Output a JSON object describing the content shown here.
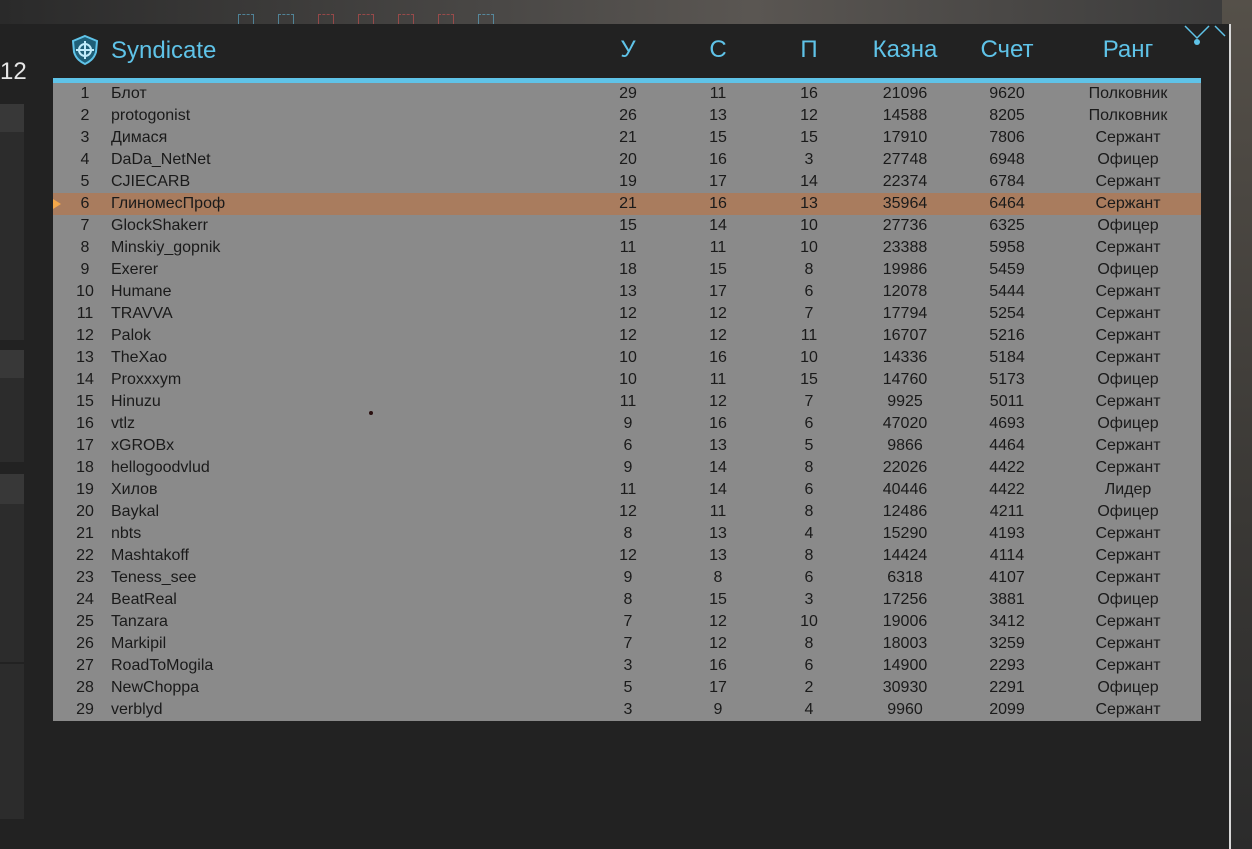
{
  "clan": {
    "name": "Syndicate",
    "logo_icon": "shield-crosshair-icon"
  },
  "side_counter": "12",
  "columns": {
    "u": "У",
    "s": "С",
    "p": "П",
    "kazna": "Казна",
    "schet": "Счет",
    "rank": "Ранг"
  },
  "colors": {
    "accent": "#5fc3e8",
    "highlight_row": "#a97c5e",
    "table_bg": "#8a8a8a",
    "marker": "#f4a84a"
  },
  "rows": [
    {
      "idx": "1",
      "name": "Блот",
      "u": "29",
      "s": "11",
      "p": "16",
      "kazna": "21096",
      "schet": "9620",
      "rank": "Полковник"
    },
    {
      "idx": "2",
      "name": "protogonist",
      "u": "26",
      "s": "13",
      "p": "12",
      "kazna": "14588",
      "schet": "8205",
      "rank": "Полковник"
    },
    {
      "idx": "3",
      "name": "Димася",
      "u": "21",
      "s": "15",
      "p": "15",
      "kazna": "17910",
      "schet": "7806",
      "rank": "Сержант"
    },
    {
      "idx": "4",
      "name": "DaDa_NetNet",
      "u": "20",
      "s": "16",
      "p": "3",
      "kazna": "27748",
      "schet": "6948",
      "rank": "Офицер"
    },
    {
      "idx": "5",
      "name": "CJIECARB",
      "u": "19",
      "s": "17",
      "p": "14",
      "kazna": "22374",
      "schet": "6784",
      "rank": "Сержант"
    },
    {
      "idx": "6",
      "name": "ГлиномесПроф",
      "u": "21",
      "s": "16",
      "p": "13",
      "kazna": "35964",
      "schet": "6464",
      "rank": "Сержант",
      "me": true
    },
    {
      "idx": "7",
      "name": "GlockShakerr",
      "u": "15",
      "s": "14",
      "p": "10",
      "kazna": "27736",
      "schet": "6325",
      "rank": "Офицер"
    },
    {
      "idx": "8",
      "name": "Minskiy_gopnik",
      "u": "11",
      "s": "11",
      "p": "10",
      "kazna": "23388",
      "schet": "5958",
      "rank": "Сержант"
    },
    {
      "idx": "9",
      "name": "Exerer",
      "u": "18",
      "s": "15",
      "p": "8",
      "kazna": "19986",
      "schet": "5459",
      "rank": "Офицер"
    },
    {
      "idx": "10",
      "name": "Humane",
      "u": "13",
      "s": "17",
      "p": "6",
      "kazna": "12078",
      "schet": "5444",
      "rank": "Сержант"
    },
    {
      "idx": "11",
      "name": "TRAVVA",
      "u": "12",
      "s": "12",
      "p": "7",
      "kazna": "17794",
      "schet": "5254",
      "rank": "Сержант"
    },
    {
      "idx": "12",
      "name": "Palok",
      "u": "12",
      "s": "12",
      "p": "11",
      "kazna": "16707",
      "schet": "5216",
      "rank": "Сержант"
    },
    {
      "idx": "13",
      "name": "TheXao",
      "u": "10",
      "s": "16",
      "p": "10",
      "kazna": "14336",
      "schet": "5184",
      "rank": "Сержант"
    },
    {
      "idx": "14",
      "name": "Proxxxym",
      "u": "10",
      "s": "11",
      "p": "15",
      "kazna": "14760",
      "schet": "5173",
      "rank": "Офицер"
    },
    {
      "idx": "15",
      "name": "Hinuzu",
      "u": "11",
      "s": "12",
      "p": "7",
      "kazna": "9925",
      "schet": "5011",
      "rank": "Сержант"
    },
    {
      "idx": "16",
      "name": "vtlz",
      "u": "9",
      "s": "16",
      "p": "6",
      "kazna": "47020",
      "schet": "4693",
      "rank": "Офицер"
    },
    {
      "idx": "17",
      "name": "xGROBx",
      "u": "6",
      "s": "13",
      "p": "5",
      "kazna": "9866",
      "schet": "4464",
      "rank": "Сержант"
    },
    {
      "idx": "18",
      "name": "hellogoodvlud",
      "u": "9",
      "s": "14",
      "p": "8",
      "kazna": "22026",
      "schet": "4422",
      "rank": "Сержант"
    },
    {
      "idx": "19",
      "name": "Хилов",
      "u": "11",
      "s": "14",
      "p": "6",
      "kazna": "40446",
      "schet": "4422",
      "rank": "Лидер"
    },
    {
      "idx": "20",
      "name": "Baykal",
      "u": "12",
      "s": "11",
      "p": "8",
      "kazna": "12486",
      "schet": "4211",
      "rank": "Офицер"
    },
    {
      "idx": "21",
      "name": "nbts",
      "u": "8",
      "s": "13",
      "p": "4",
      "kazna": "15290",
      "schet": "4193",
      "rank": "Сержант"
    },
    {
      "idx": "22",
      "name": "Mashtakoff",
      "u": "12",
      "s": "13",
      "p": "8",
      "kazna": "14424",
      "schet": "4114",
      "rank": "Сержант"
    },
    {
      "idx": "23",
      "name": "Teness_see",
      "u": "9",
      "s": "8",
      "p": "6",
      "kazna": "6318",
      "schet": "4107",
      "rank": "Сержант"
    },
    {
      "idx": "24",
      "name": "BeatReal",
      "u": "8",
      "s": "15",
      "p": "3",
      "kazna": "17256",
      "schet": "3881",
      "rank": "Офицер"
    },
    {
      "idx": "25",
      "name": "Tanzara",
      "u": "7",
      "s": "12",
      "p": "10",
      "kazna": "19006",
      "schet": "3412",
      "rank": "Сержант"
    },
    {
      "idx": "26",
      "name": "Markipil",
      "u": "7",
      "s": "12",
      "p": "8",
      "kazna": "18003",
      "schet": "3259",
      "rank": "Сержант"
    },
    {
      "idx": "27",
      "name": "RoadToMogila",
      "u": "3",
      "s": "16",
      "p": "6",
      "kazna": "14900",
      "schet": "2293",
      "rank": "Сержант"
    },
    {
      "idx": "28",
      "name": "NewChoppa",
      "u": "5",
      "s": "17",
      "p": "2",
      "kazna": "30930",
      "schet": "2291",
      "rank": "Офицер"
    },
    {
      "idx": "29",
      "name": "verblyd",
      "u": "3",
      "s": "9",
      "p": "4",
      "kazna": "9960",
      "schet": "2099",
      "rank": "Сержант"
    }
  ]
}
